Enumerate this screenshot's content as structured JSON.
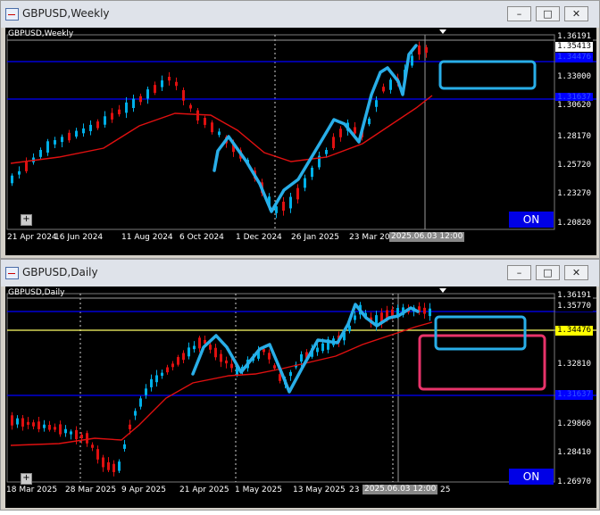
{
  "windows": [
    {
      "title": "GBPUSD,Weekly",
      "chart_label": "GBPUSD,Weekly",
      "price_labels": [
        {
          "text": "1.36191",
          "color": "#ffffff",
          "bg": "#000000"
        },
        {
          "text": "1.35413",
          "color": "#000000",
          "bg": "#ffffff"
        },
        {
          "text": "1.34476",
          "color": "#0000ff",
          "bg": "#0000ff"
        },
        {
          "text": "1.33000",
          "color": "#ffffff",
          "bg": "#000000"
        },
        {
          "text": "1.31637",
          "color": "#0000ff",
          "bg": "#0000ff"
        },
        {
          "text": "1.30620",
          "color": "#ffffff",
          "bg": "#000000"
        },
        {
          "text": "1.28170",
          "color": "#ffffff",
          "bg": "#000000"
        },
        {
          "text": "1.25720",
          "color": "#ffffff",
          "bg": "#000000"
        },
        {
          "text": "1.23270",
          "color": "#ffffff",
          "bg": "#000000"
        },
        {
          "text": "1.20820",
          "color": "#ffffff",
          "bg": "#000000"
        }
      ],
      "time_labels": [
        "21 Apr 2024",
        "16 Jun 2024",
        "11 Aug 2024",
        "6 Oct 2024",
        "1 Dec 2024",
        "26 Jan 2025",
        "23 Mar 20"
      ],
      "cursor_time": "2025.06.03 12:00",
      "on_label": "ON"
    },
    {
      "title": "GBPUSD,Daily",
      "chart_label": "GBPUSD,Daily",
      "price_labels": [
        {
          "text": "1.36191",
          "color": "#ffffff",
          "bg": "#000000"
        },
        {
          "text": "1.35770",
          "color": "#ffffff",
          "bg": "#000000"
        },
        {
          "text": "1.34476",
          "color": "#000000",
          "bg": "#ffff00"
        },
        {
          "text": "1.32810",
          "color": "#ffffff",
          "bg": "#000000"
        },
        {
          "text": "1.31637",
          "color": "#0000ff",
          "bg": "#0000ff"
        },
        {
          "text": "1.29860",
          "color": "#ffffff",
          "bg": "#000000"
        },
        {
          "text": "1.28410",
          "color": "#ffffff",
          "bg": "#000000"
        },
        {
          "text": "1.26970",
          "color": "#ffffff",
          "bg": "#000000"
        }
      ],
      "time_labels": [
        "18 Mar 2025",
        "28 Mar 2025",
        "9 Apr 2025",
        "21 Apr 2025",
        "1 May 2025",
        "13 May 2025",
        "23 M"
      ],
      "time_tail": "25",
      "cursor_time": "2025.06.03 12:00",
      "on_label": "ON"
    }
  ],
  "controls": {
    "minimize": "–",
    "maximize": "□",
    "close": "✕"
  },
  "colors": {
    "bull": "#00b0e8",
    "bear": "#e01010",
    "ma": "#e01010",
    "hline": "#0000ff",
    "support": "#ffff66",
    "zigzag": "#29aee8",
    "box_blue": "#29aee8",
    "box_pink": "#e8336a"
  },
  "icons": {
    "window_icon": "chart-window-icon",
    "scale_fix": "plus-icon"
  }
}
